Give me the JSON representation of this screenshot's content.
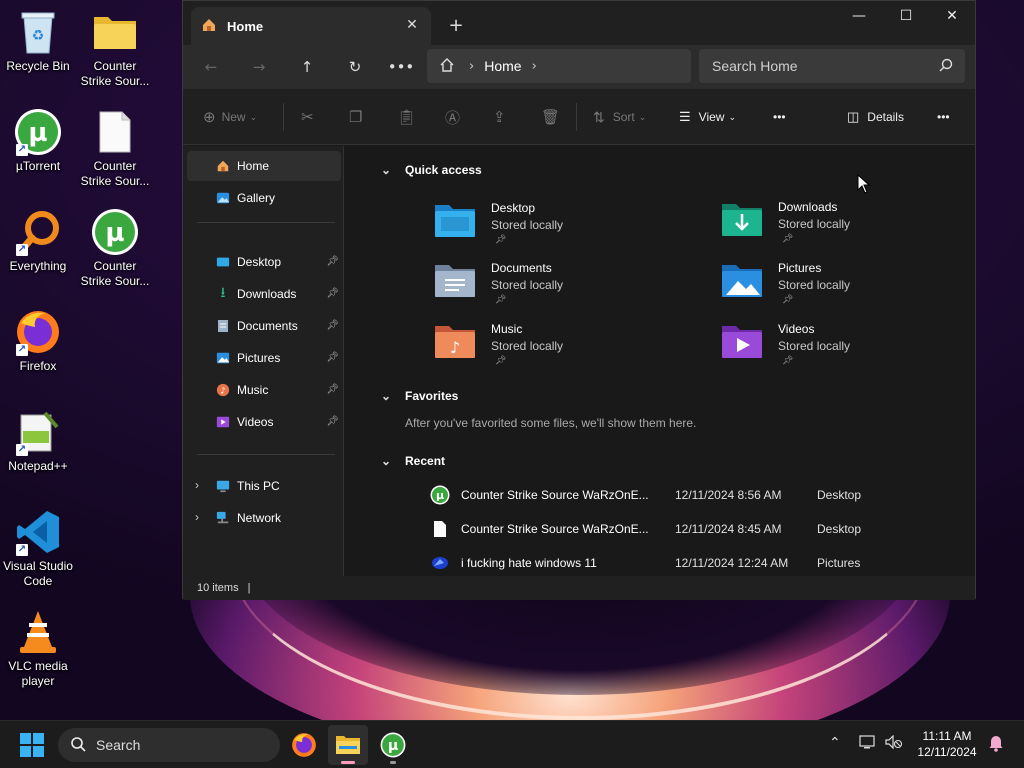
{
  "desktop": {
    "icons": [
      {
        "label": "Recycle Bin",
        "icon": "recycle-bin-icon"
      },
      {
        "label": "Counter Strike Sour...",
        "icon": "folder-icon"
      },
      {
        "label": "µTorrent",
        "icon": "utorrent-icon"
      },
      {
        "label": "Counter Strike Sour...",
        "icon": "document-icon"
      },
      {
        "label": "Everything",
        "icon": "everything-search-icon"
      },
      {
        "label": "Counter Strike Sour...",
        "icon": "utorrent-icon"
      },
      {
        "label": "Firefox",
        "icon": "firefox-icon"
      },
      {
        "label": "Notepad++",
        "icon": "notepad-plus-plus-icon"
      },
      {
        "label": "Visual Studio Code",
        "icon": "vscode-icon"
      },
      {
        "label": "VLC media player",
        "icon": "vlc-icon"
      }
    ]
  },
  "explorer": {
    "tab": {
      "title": "Home",
      "icon": "home-icon"
    },
    "address": {
      "parts": [
        "Home"
      ]
    },
    "search": {
      "placeholder": "Search Home"
    },
    "toolbar": {
      "new_label": "New",
      "sort_label": "Sort",
      "view_label": "View",
      "details_label": "Details"
    },
    "sidebar": {
      "top": [
        {
          "label": "Home",
          "icon": "home-icon",
          "selected": true
        },
        {
          "label": "Gallery",
          "icon": "gallery-icon"
        }
      ],
      "pinned": [
        {
          "label": "Desktop",
          "icon": "desktop-folder-icon"
        },
        {
          "label": "Downloads",
          "icon": "downloads-icon"
        },
        {
          "label": "Documents",
          "icon": "documents-icon"
        },
        {
          "label": "Pictures",
          "icon": "pictures-icon"
        },
        {
          "label": "Music",
          "icon": "music-icon"
        },
        {
          "label": "Videos",
          "icon": "videos-icon"
        }
      ],
      "drives": [
        {
          "label": "This PC",
          "icon": "this-pc-icon"
        },
        {
          "label": "Network",
          "icon": "network-icon"
        }
      ]
    },
    "sections": {
      "quick_access": "Quick access",
      "favorites": "Favorites",
      "favorites_empty": "After you've favorited some files, we'll show them here.",
      "recent": "Recent"
    },
    "quick_access": [
      {
        "name": "Desktop",
        "sub": "Stored locally",
        "color": "#2fa8e8"
      },
      {
        "name": "Downloads",
        "sub": "Stored locally",
        "color": "#1db58f"
      },
      {
        "name": "Documents",
        "sub": "Stored locally",
        "color": "#8ea4bc"
      },
      {
        "name": "Pictures",
        "sub": "Stored locally",
        "color": "#2a8fe0"
      },
      {
        "name": "Music",
        "sub": "Stored locally",
        "color": "#e8754a"
      },
      {
        "name": "Videos",
        "sub": "Stored locally",
        "color": "#9a4ad8"
      }
    ],
    "recent": [
      {
        "name": "Counter Strike Source WaRzOnE...",
        "date": "12/11/2024 8:56 AM",
        "location": "Desktop",
        "icon": "utorrent-icon"
      },
      {
        "name": "Counter Strike Source WaRzOnE...",
        "date": "12/11/2024 8:45 AM",
        "location": "Desktop",
        "icon": "document-icon"
      },
      {
        "name": "i fucking hate windows 11",
        "date": "12/11/2024 12:24 AM",
        "location": "Pictures",
        "icon": "image-file-icon"
      }
    ],
    "status": {
      "items": "10 items"
    }
  },
  "taskbar": {
    "search_placeholder": "Search",
    "time": "11:11 AM",
    "date": "12/11/2024"
  }
}
